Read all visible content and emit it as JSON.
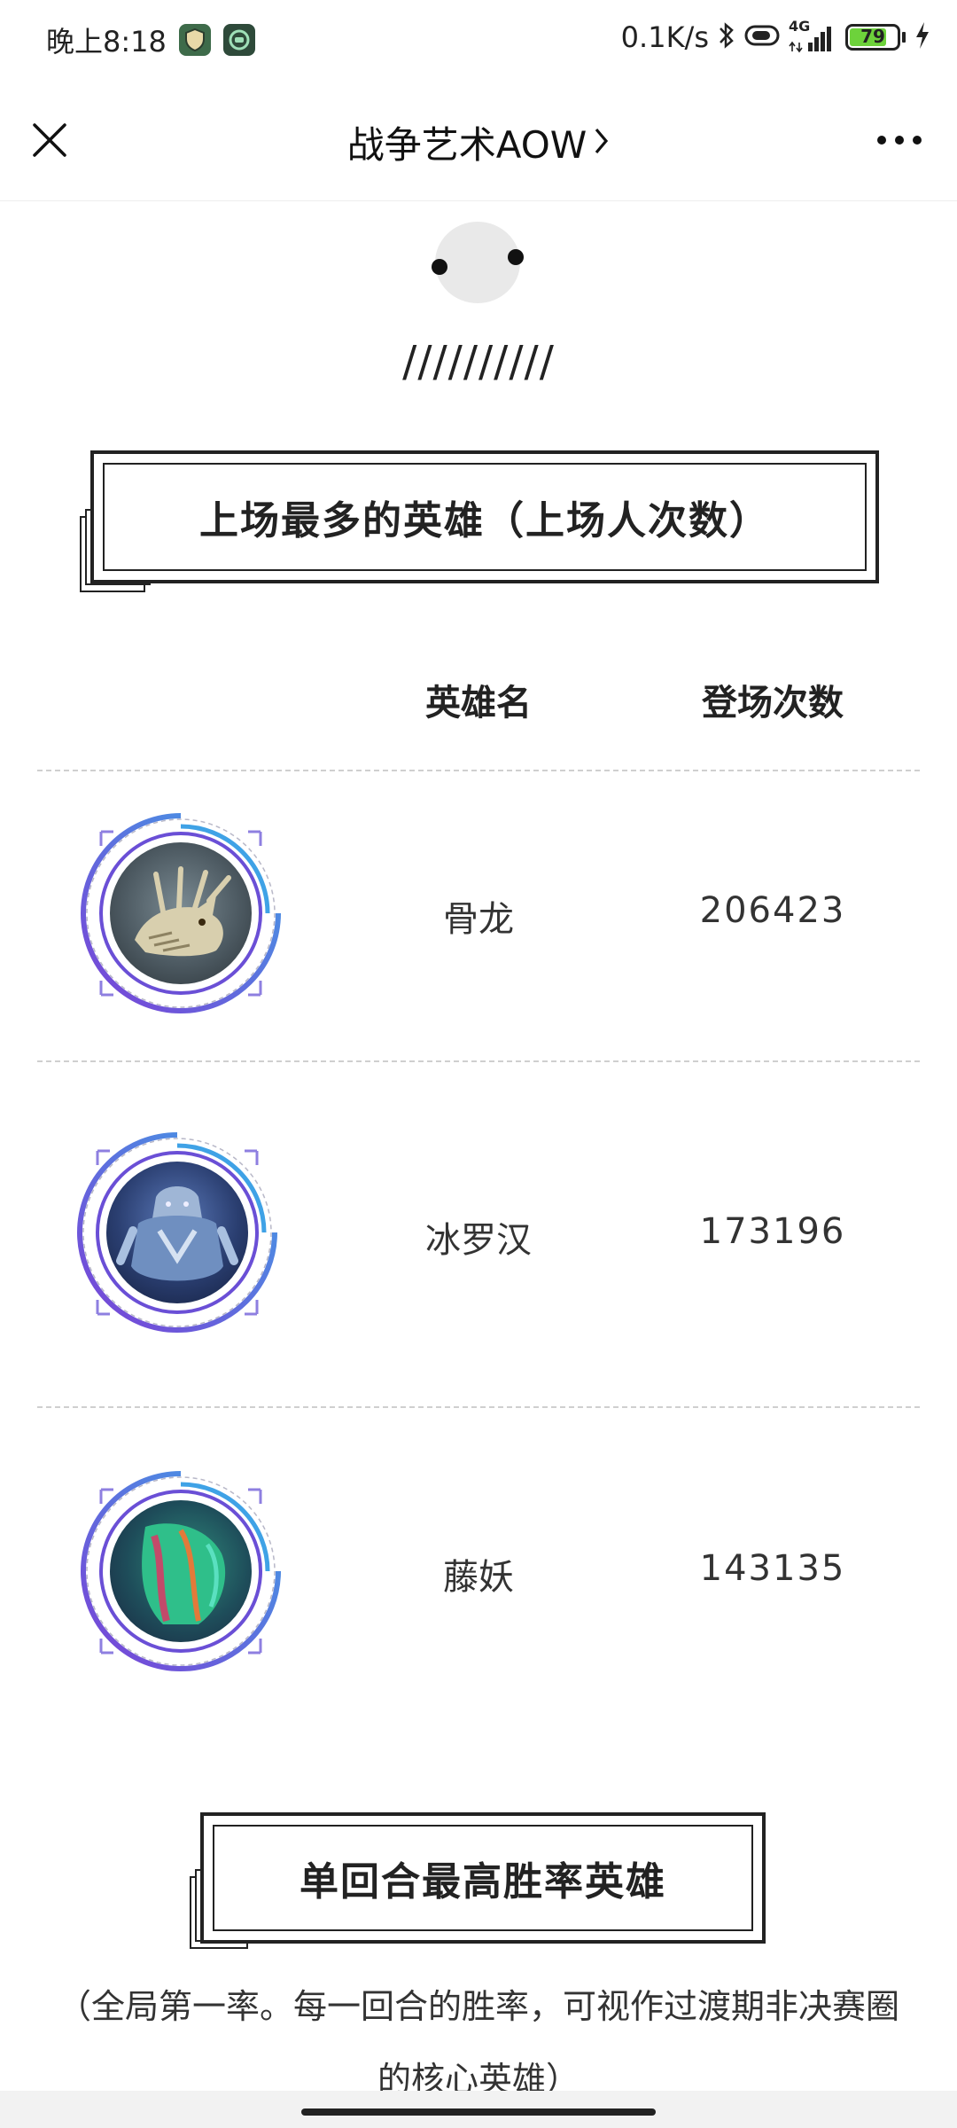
{
  "status_bar": {
    "time": "晚上8:18",
    "net_speed": "0.1K/s",
    "network_type": "4G",
    "battery_level": "79",
    "icons": [
      "shield-app-icon",
      "assistant-app-icon",
      "bluetooth-icon",
      "toggle-icon",
      "signal-icon",
      "battery-icon",
      "charging-icon"
    ]
  },
  "nav": {
    "title": "战争艺术AOW",
    "icons": [
      "close-icon",
      "chevron-right-icon",
      "more-icon"
    ]
  },
  "decoration": {
    "slashes": "//////////"
  },
  "section1": {
    "title": "上场最多的英雄（上场人次数）"
  },
  "table": {
    "headers": {
      "name": "英雄名",
      "count": "登场次数"
    },
    "rows": [
      {
        "name": "骨龙",
        "count": "206423",
        "portrait": "bone-dragon"
      },
      {
        "name": "冰罗汉",
        "count": "173196",
        "portrait": "ice-arhat"
      },
      {
        "name": "藤妖",
        "count": "143135",
        "portrait": "vine-demon"
      }
    ]
  },
  "section2": {
    "title": "单回合最高胜率英雄",
    "description": "（全局第一率。每一回合的胜率，可视作过渡期非决赛圈的核心英雄）"
  },
  "colors": {
    "ring_purple": "#7b3fd6",
    "ring_blue": "#3fa2e6",
    "battery_green": "#6dd23b"
  }
}
